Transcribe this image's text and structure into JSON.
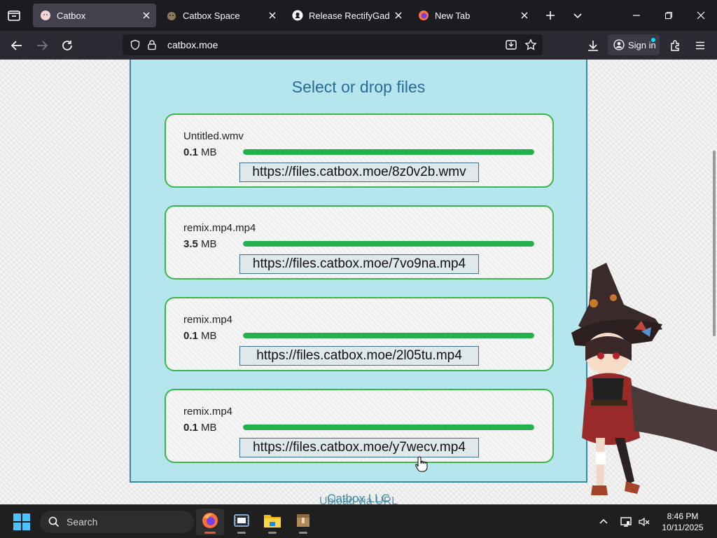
{
  "browser": {
    "tabs": [
      {
        "label": "Catbox",
        "active": true,
        "icon": "catbox-favicon"
      },
      {
        "label": "Catbox Space",
        "active": false,
        "icon": "catbox-space-favicon"
      },
      {
        "label": "Release RectifyGadgets",
        "active": false,
        "icon": "github-icon"
      },
      {
        "label": "New Tab",
        "active": false,
        "icon": "firefox-icon"
      }
    ],
    "url": "catbox.moe",
    "signin_label": "Sign in"
  },
  "page": {
    "title": "Select or drop files",
    "files": [
      {
        "name": "Untitled.wmv",
        "size_value": "0.1",
        "size_unit": "MB",
        "progress": 1.0,
        "link": "https://files.catbox.moe/8z0v2b.wmv"
      },
      {
        "name": "remix.mp4.mp4",
        "size_value": "3.5",
        "size_unit": "MB",
        "progress": 1.0,
        "link": "https://files.catbox.moe/7vo9na.mp4"
      },
      {
        "name": "remix.mp4",
        "size_value": "0.1",
        "size_unit": "MB",
        "progress": 1.0,
        "link": "https://files.catbox.moe/2l05tu.mp4"
      },
      {
        "name": "remix.mp4",
        "size_value": "0.1",
        "size_unit": "MB",
        "progress": 1.0,
        "link": "https://files.catbox.moe/y7wecv.mp4"
      }
    ],
    "footer_company": "Catbox LLC",
    "footer_upload_url": "Upload via URL"
  },
  "taskbar": {
    "search_label": "Search",
    "apps": [
      "firefox-icon",
      "media-player-icon",
      "file-explorer-icon",
      "archive-icon"
    ],
    "time": "8:46 PM",
    "date": "10/11/2025"
  },
  "colors": {
    "panel_bg": "#b5e6ee",
    "card_border": "#3cb44b",
    "progress": "#22b14c",
    "title": "#2a6a9a"
  }
}
